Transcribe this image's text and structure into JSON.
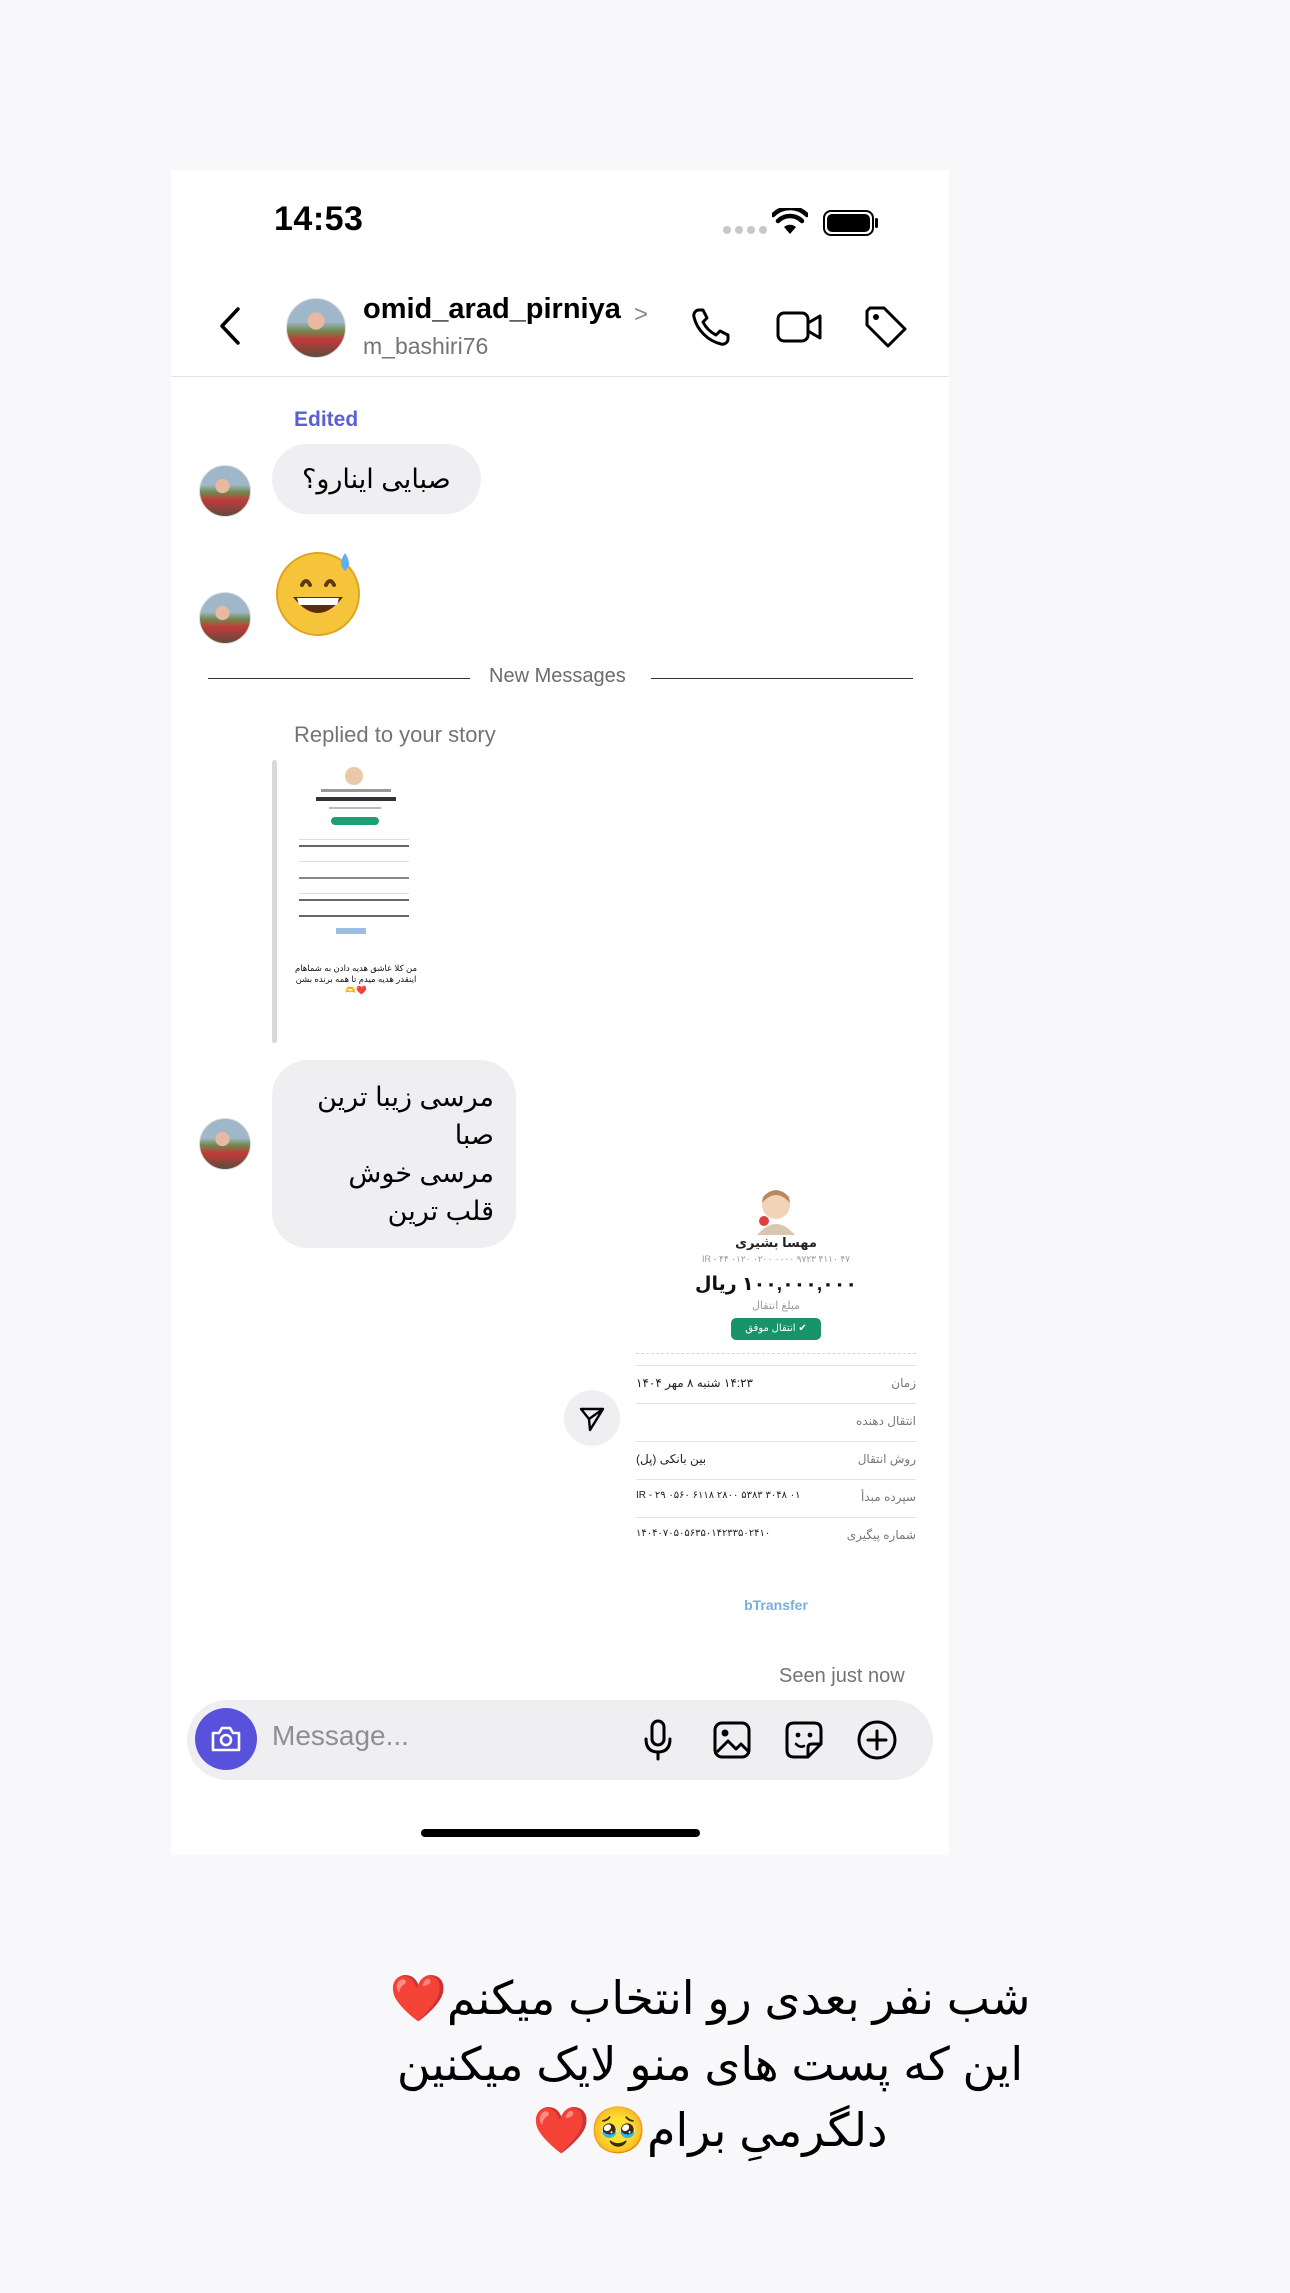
{
  "status_bar": {
    "time": "14:53"
  },
  "header": {
    "display_name": "omid_arad_pirniya",
    "username": "m_bashiri76",
    "chevron": ">",
    "icons": [
      "back-chevron-icon",
      "phone-icon",
      "video-camera-icon",
      "tag-icon"
    ]
  },
  "messages": {
    "edited_label": "Edited",
    "msg1_text": "صبایی اینارو؟",
    "msg2_emoji": "grinning-sweat-emoji",
    "new_messages_label": "New Messages",
    "replied_label": "Replied to your story",
    "story_caption_line1": "من کلا عاشق هدیه دادن به شماهام",
    "story_caption_line2": "اینقدر هدیه میدم تا همه برنده بشن❤️🫶",
    "msg3_line1": "مرسی زیبا ترین صبا",
    "msg3_line2": "مرسی خوش قلب ترین",
    "seen_label": "Seen just now"
  },
  "receipt": {
    "name": "مهسا بشیری",
    "iban": "IR - ۴۴ ۰۱۲۰ ۰۲۰۰ ۰۰۰۰ ۹۷۲۳ ۴۱۱۰ ۴۷",
    "amount": "۱۰۰,۰۰۰,۰۰۰ ریال",
    "amount_label": "مبلغ انتقال",
    "status_badge": "انتقال موفق",
    "rows": [
      {
        "label": "زمان",
        "value": "۱۴:۲۳  شنبه ۸ مهر ۱۴۰۴"
      },
      {
        "label": "انتقال دهنده",
        "value": ""
      },
      {
        "label": "روش انتقال",
        "value": "بین بانکی (پل)"
      },
      {
        "label": "سپرده مبدأ",
        "value": "IR - ۲۹ ۰۵۶۰ ۶۱۱۸ ۲۸۰۰ ۵۳۸۳ ۳۰۴۸ ۰۱"
      },
      {
        "label": "شماره پیگیری",
        "value": "۱۴۰۴۰۷۰۵۰۵۶۳۵۰۱۴۲۳۳۵۰۲۴۱۰"
      }
    ],
    "brand": "bTransfer"
  },
  "composer": {
    "placeholder": "Message...",
    "icons": [
      "camera-icon",
      "microphone-icon",
      "gallery-icon",
      "sticker-icon",
      "plus-circle-icon"
    ]
  },
  "caption": {
    "line1": "شب  نفر بعدی رو انتخاب میکنم❤️",
    "line2": "این که پست های منو لایک میکنین",
    "line3": "دلگرمیِ برام🥹❤️"
  }
}
